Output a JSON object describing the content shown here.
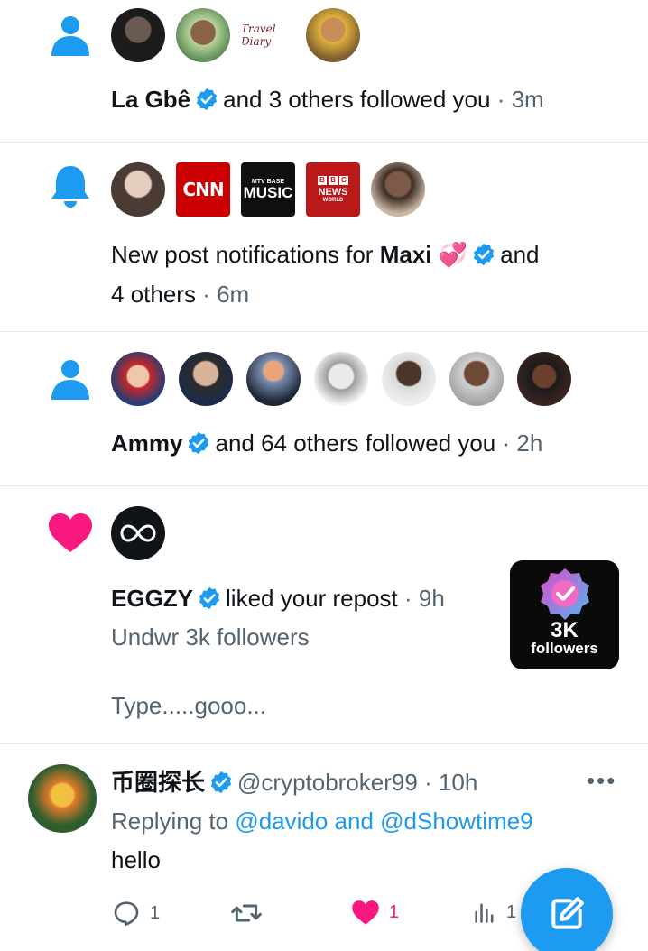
{
  "notifications": [
    {
      "icon": "person-icon",
      "actor": "La Gbê",
      "text": "and 3 others followed you",
      "sep": "·",
      "time": "3m"
    },
    {
      "icon": "bell-icon",
      "prefix": "New post notifications for",
      "actor": "Maxi",
      "emoji": "💞",
      "and": "and",
      "line2": "4 others",
      "sep": "·",
      "time": "6m",
      "brands": {
        "cnn": "CNN",
        "music_small": "MTV BASE",
        "music": "MUSIC",
        "bbc_boxes": [
          "B",
          "B",
          "C"
        ],
        "bbc_news": "NEWS",
        "bbc_world": "WORLD"
      },
      "travel_logo": "Travel Diary"
    },
    {
      "icon": "person-icon",
      "actor": "Ammy",
      "text": "and 64 others followed you",
      "sep": "·",
      "time": "2h"
    },
    {
      "icon": "heart-icon",
      "actor": "EGGZY",
      "text": "liked your repost",
      "sep": "·",
      "time": "9h",
      "subtext": "Undwr 3k followers",
      "body": "Type.....gooo...",
      "thumb_big": "3K",
      "thumb_small": "followers"
    }
  ],
  "tweet": {
    "name": "币圈探长",
    "handle": "@cryptobroker99",
    "sep": "·",
    "time": "10h",
    "replying_prefix": "Replying to",
    "replying_to": "@davido and @dShowtime9",
    "text": "hello",
    "more": "•••",
    "actions": {
      "reply_count": "1",
      "like_count": "1",
      "views_count": "1"
    }
  },
  "colors": {
    "accent": "#1d9bf0",
    "heart": "#f91880",
    "text": "#0f1419",
    "muted": "#536471"
  }
}
